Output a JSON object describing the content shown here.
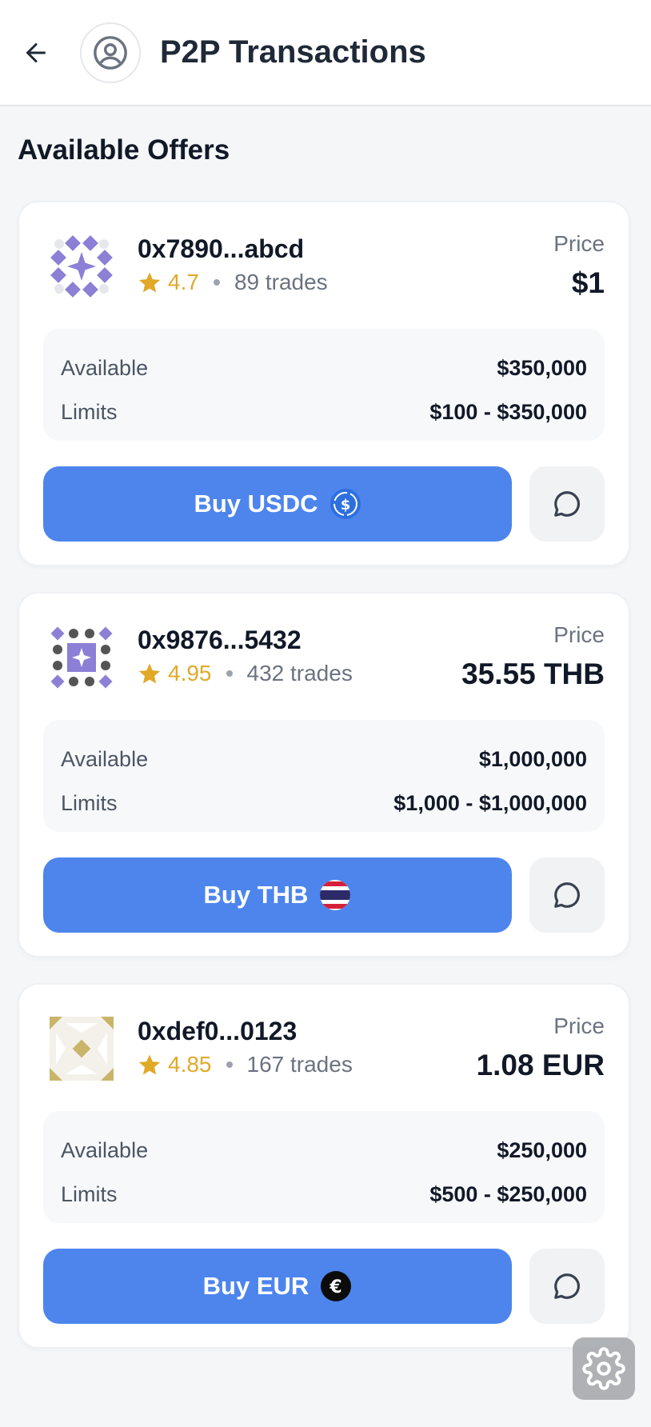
{
  "header": {
    "title": "P2P Transactions",
    "back_icon": "arrow-left-icon",
    "avatar_icon": "user-circle-icon"
  },
  "section_title": "Available Offers",
  "colors": {
    "accent": "#4d85ed",
    "rating": "#e0a928",
    "card_bg": "#ffffff",
    "page_bg": "#f5f6f8"
  },
  "offers": [
    {
      "address": "0x7890...abcd",
      "rating": "4.7",
      "trades": "89 trades",
      "price_label": "Price",
      "price": "$1",
      "available_label": "Available",
      "available": "$350,000",
      "limits_label": "Limits",
      "limits": "$100 - $350,000",
      "buy_label": "Buy USDC",
      "coin_icon": "usdc-icon"
    },
    {
      "address": "0x9876...5432",
      "rating": "4.95",
      "trades": "432 trades",
      "price_label": "Price",
      "price": "35.55 THB",
      "available_label": "Available",
      "available": "$1,000,000",
      "limits_label": "Limits",
      "limits": "$1,000 - $1,000,000",
      "buy_label": "Buy THB",
      "coin_icon": "thailand-flag-icon"
    },
    {
      "address": "0xdef0...0123",
      "rating": "4.85",
      "trades": "167 trades",
      "price_label": "Price",
      "price": "1.08 EUR",
      "available_label": "Available",
      "available": "$250,000",
      "limits_label": "Limits",
      "limits": "$500 - $250,000",
      "buy_label": "Buy EUR",
      "coin_icon": "euro-icon"
    }
  ]
}
